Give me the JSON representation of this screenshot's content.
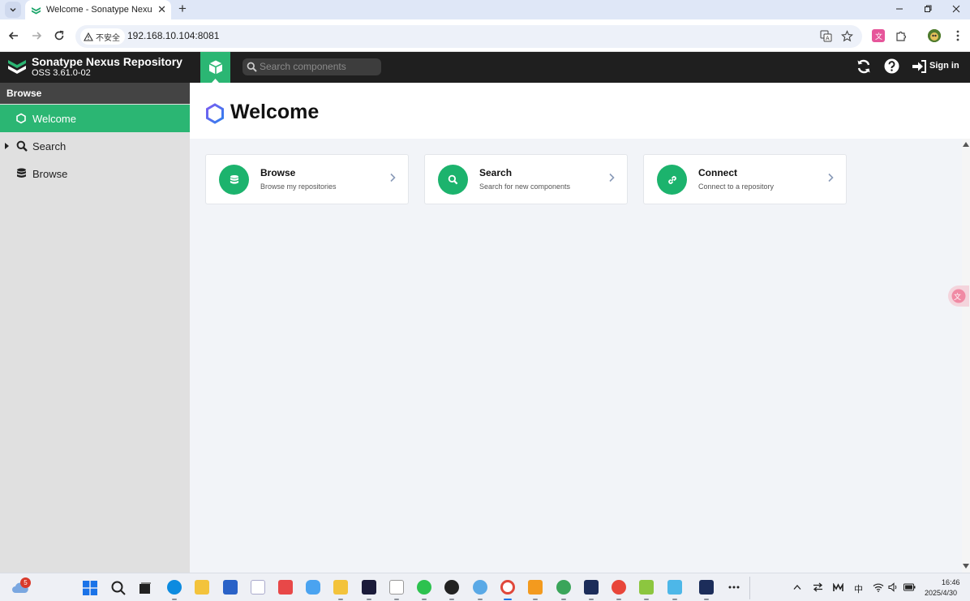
{
  "browser": {
    "tab_title": "Welcome - Sonatype Nexus",
    "tab_close": "✕",
    "new_tab": "+",
    "security_label": "不安全",
    "url": "192.168.10.104:8081"
  },
  "nexus": {
    "app_title": "Sonatype Nexus Repository",
    "version": "OSS 3.61.0-02",
    "search_placeholder": "Search components",
    "sign_in": "Sign in"
  },
  "sidebar": {
    "header": "Browse",
    "items": [
      {
        "label": "Welcome",
        "active": true
      },
      {
        "label": "Search",
        "active": false
      },
      {
        "label": "Browse",
        "active": false
      }
    ]
  },
  "main": {
    "title": "Welcome",
    "cards": [
      {
        "title": "Browse",
        "subtitle": "Browse my repositories",
        "icon": "database-icon"
      },
      {
        "title": "Search",
        "subtitle": "Search for new components",
        "icon": "search-icon"
      },
      {
        "title": "Connect",
        "subtitle": "Connect to a repository",
        "icon": "link-icon"
      }
    ]
  },
  "taskbar": {
    "badge_count": "5",
    "ime": "中",
    "time": "16:46",
    "date": "2025/4/30"
  },
  "colors": {
    "accent_green": "#2bb673",
    "header_dark": "#1f1f1f",
    "sidebar_bg": "#e0e0e0",
    "hex_outline": "#5b5bd6"
  }
}
